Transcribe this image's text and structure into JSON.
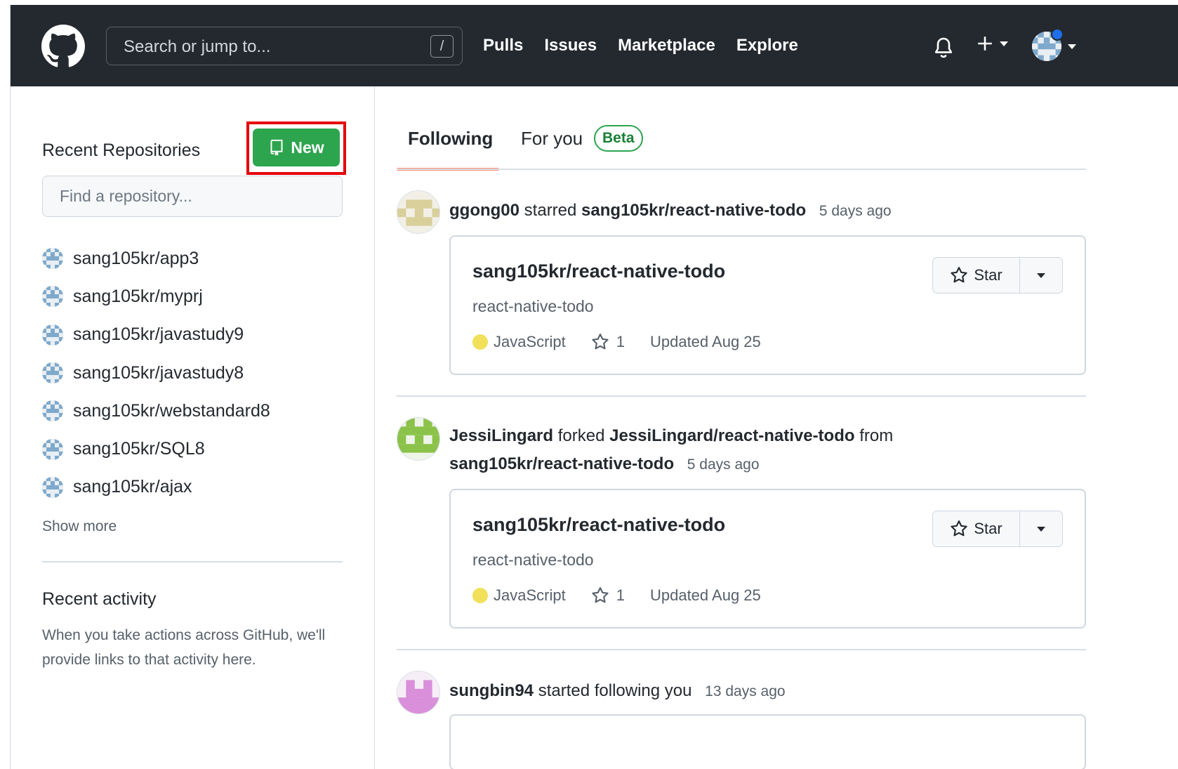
{
  "header": {
    "search_placeholder": "Search or jump to...",
    "search_shortcut": "/",
    "nav": [
      "Pulls",
      "Issues",
      "Marketplace",
      "Explore"
    ]
  },
  "sidebar": {
    "title": "Recent Repositories",
    "new_button": "New",
    "find_placeholder": "Find a repository...",
    "repos": [
      "sang105kr/app3",
      "sang105kr/myprj",
      "sang105kr/javastudy9",
      "sang105kr/javastudy8",
      "sang105kr/webstandard8",
      "sang105kr/SQL8",
      "sang105kr/ajax"
    ],
    "show_more": "Show more",
    "activity_title": "Recent activity",
    "activity_text": "When you take actions across GitHub, we'll provide links to that activity here."
  },
  "tabs": {
    "following": "Following",
    "for_you": "For you",
    "beta": "Beta"
  },
  "feed": {
    "event1": {
      "actor": "ggong00",
      "action": "starred",
      "target": "sang105kr/react-native-todo",
      "time": "5 days ago",
      "card": {
        "title": "sang105kr/react-native-todo",
        "desc": "react-native-todo",
        "language": "JavaScript",
        "stars": "1",
        "updated": "Updated Aug 25",
        "star_label": "Star"
      }
    },
    "event2": {
      "actor": "JessiLingard",
      "action": "forked",
      "target": "JessiLingard/react-native-todo",
      "from_word": "from",
      "source": "sang105kr/react-native-todo",
      "time": "5 days ago",
      "card": {
        "title": "sang105kr/react-native-todo",
        "desc": "react-native-todo",
        "language": "JavaScript",
        "stars": "1",
        "updated": "Updated Aug 25",
        "star_label": "Star"
      }
    },
    "event3": {
      "actor": "sungbin94",
      "action": "started following you",
      "time": "13 days ago"
    }
  },
  "colors": {
    "header_bg": "#24292f",
    "new_button": "#2da44e",
    "highlight_box": "#e5000b",
    "tab_underline": "#fd8c73",
    "javascript": "#f1e05a"
  },
  "icons": [
    "github-logo-icon",
    "bell-icon",
    "plus-icon",
    "repo-icon",
    "star-icon",
    "chevron-down-icon"
  ]
}
